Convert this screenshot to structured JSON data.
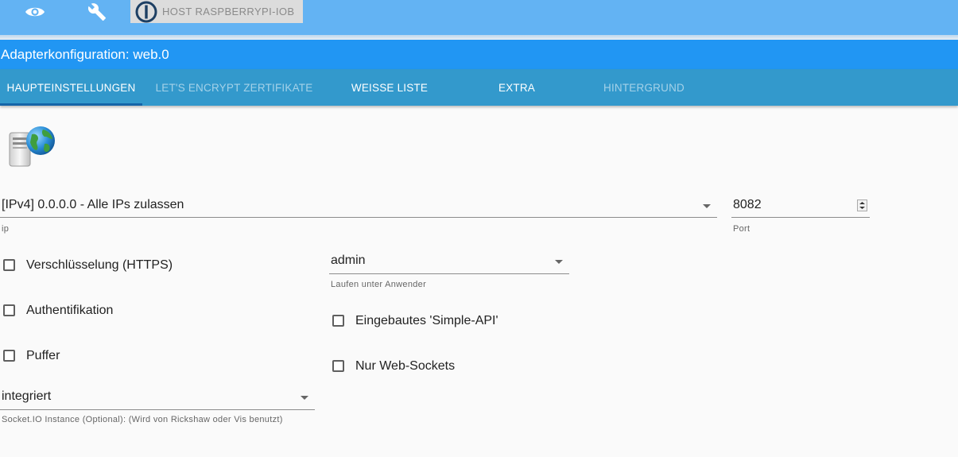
{
  "toolbar": {
    "host_label": "HOST RASPBERRYPI-IOB",
    "icons": [
      "eye-icon",
      "wrench-icon",
      "iobroker-logo-icon"
    ]
  },
  "header": {
    "title": "Adapterkonfiguration: web.0"
  },
  "tabs": [
    {
      "label": "HAUPTEINSTELLUNGEN",
      "state": "active"
    },
    {
      "label": "LET'S ENCRYPT ZERTIFIKATE",
      "state": "disabled"
    },
    {
      "label": "WEISSE LISTE",
      "state": "normal"
    },
    {
      "label": "EXTRA",
      "state": "normal"
    },
    {
      "label": "HINTERGRUND",
      "state": "disabled"
    }
  ],
  "form": {
    "ip": {
      "value": "[IPv4] 0.0.0.0 - Alle IPs zulassen",
      "helper": "ip"
    },
    "port": {
      "value": "8082",
      "helper": "Port"
    },
    "run_as": {
      "value": "admin",
      "helper": "Laufen unter Anwender"
    },
    "socketio": {
      "value": "integriert",
      "helper": "Socket.IO Instance (Optional): (Wird von Rickshaw oder Vis benutzt)"
    },
    "checkboxes": {
      "https": {
        "label": "Verschlüsselung (HTTPS)",
        "checked": false
      },
      "auth": {
        "label": "Authentifikation",
        "checked": false
      },
      "cache": {
        "label": "Puffer",
        "checked": false
      },
      "simple_api": {
        "label": "Eingebautes 'Simple-API'",
        "checked": false
      },
      "web_sockets": {
        "label": "Nur Web-Sockets",
        "checked": false
      }
    }
  },
  "colors": {
    "toolbar": "#63b3f3",
    "header": "#2196f3",
    "tabs": "#3399cc"
  }
}
